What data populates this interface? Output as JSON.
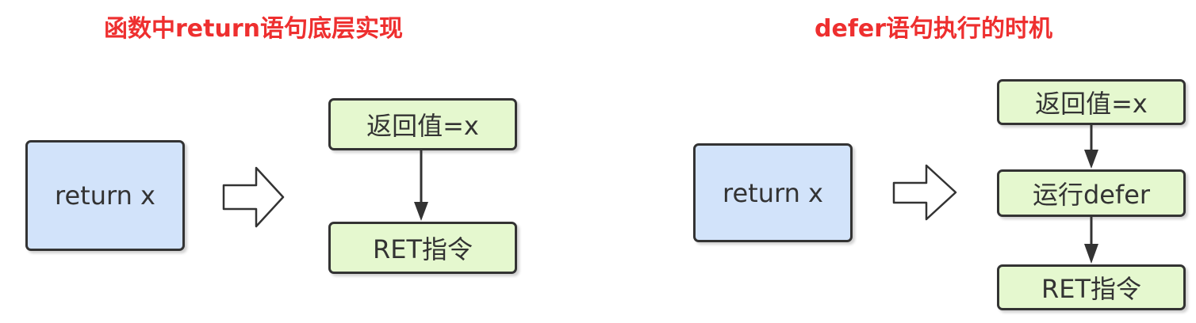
{
  "colors": {
    "title": "#ee2f2f",
    "blue_box": "#d2e3fa",
    "green_box": "#e5f8cf",
    "stroke": "#333333"
  },
  "left": {
    "title": "函数中return语句底层实现",
    "source_box": "return x",
    "steps": [
      "返回值=x",
      "RET指令"
    ]
  },
  "right": {
    "title": "defer语句执行的时机",
    "source_box": "return x",
    "steps": [
      "返回值=x",
      "运行defer",
      "RET指令"
    ]
  }
}
